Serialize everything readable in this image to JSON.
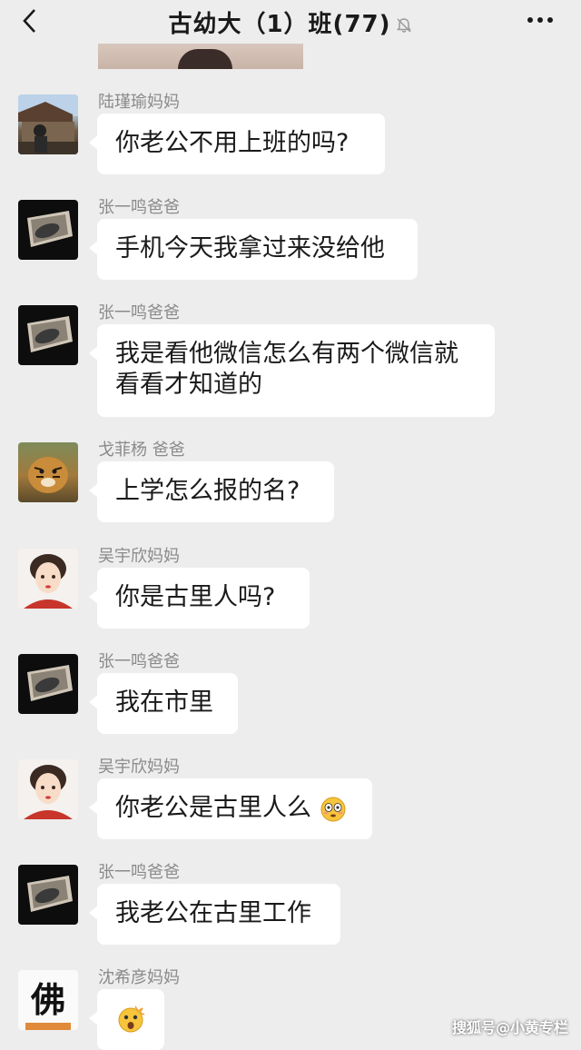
{
  "header": {
    "title": "古幼大（1）班(77)",
    "muted": true
  },
  "messages": [
    {
      "sender": "陆瑾瑜妈妈",
      "text": "你老公不用上班的吗?",
      "avatar": "garden-avatar"
    },
    {
      "sender": "张一鸣爸爸",
      "text": "手机今天我拿过来没给他",
      "avatar": "peacock-avatar"
    },
    {
      "sender": "张一鸣爸爸",
      "text_line1": "我是看他微信怎么有两个微信就",
      "text_line2": "看看才知道的",
      "avatar": "peacock-avatar"
    },
    {
      "sender": "戈菲杨 爸爸",
      "text": "上学怎么报的名?",
      "avatar": "tiger-avatar"
    },
    {
      "sender": "吴宇欣妈妈",
      "text": "你是古里人吗?",
      "avatar": "girl-avatar"
    },
    {
      "sender": "张一鸣爸爸",
      "text": "我在市里",
      "avatar": "peacock-avatar"
    },
    {
      "sender": "吴宇欣妈妈",
      "text": "你老公是古里人么",
      "emoji": "flushed-face",
      "avatar": "girl-avatar"
    },
    {
      "sender": "张一鸣爸爸",
      "text": "我老公在古里工作",
      "avatar": "peacock-avatar"
    },
    {
      "sender": "沈希彦妈妈",
      "text": "",
      "emoji": "astonished-face",
      "avatar_text": "佛"
    }
  ],
  "watermark": "搜狐号@小黄专栏",
  "colors": {
    "background": "#ededed",
    "bubble": "#ffffff",
    "name": "#8a8a8a"
  }
}
